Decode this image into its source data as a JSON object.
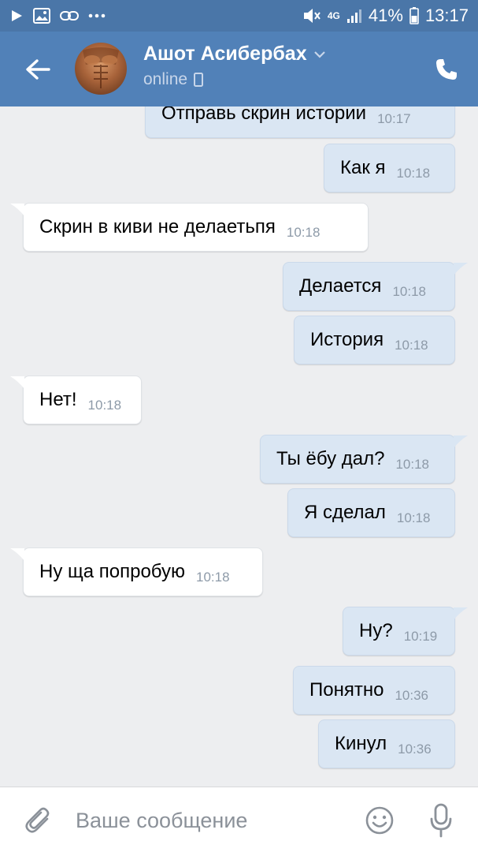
{
  "status_bar": {
    "battery": "41%",
    "time": "13:17",
    "network": "4G"
  },
  "header": {
    "contact_name": "Ашот Асибербах",
    "status": "online"
  },
  "messages": [
    {
      "direction": "out",
      "text": "Отправь скрин истории",
      "time": "10:17"
    },
    {
      "direction": "out",
      "text": "Как я",
      "time": "10:18"
    },
    {
      "direction": "in",
      "text": "Скрин в киви не делаетьпя",
      "time": "10:18"
    },
    {
      "direction": "out",
      "text": "Делается",
      "time": "10:18"
    },
    {
      "direction": "out",
      "text": "История",
      "time": "10:18"
    },
    {
      "direction": "in",
      "text": "Нет!",
      "time": "10:18"
    },
    {
      "direction": "out",
      "text": "Ты ёбу дал?",
      "time": "10:18"
    },
    {
      "direction": "out",
      "text": "Я сделал",
      "time": "10:18"
    },
    {
      "direction": "in",
      "text": "Ну ща попробую",
      "time": "10:18"
    },
    {
      "direction": "out",
      "text": "Ну?",
      "time": "10:19"
    },
    {
      "direction": "out",
      "text": "Понятно",
      "time": "10:36"
    },
    {
      "direction": "out",
      "text": "Кинул",
      "time": "10:36"
    }
  ],
  "composer": {
    "placeholder": "Ваше сообщение"
  },
  "colors": {
    "header": "#5181b8",
    "status_bar": "#4a76a8",
    "outgoing_bubble": "#dae6f3",
    "incoming_bubble": "#ffffff",
    "background": "#edeef0"
  }
}
